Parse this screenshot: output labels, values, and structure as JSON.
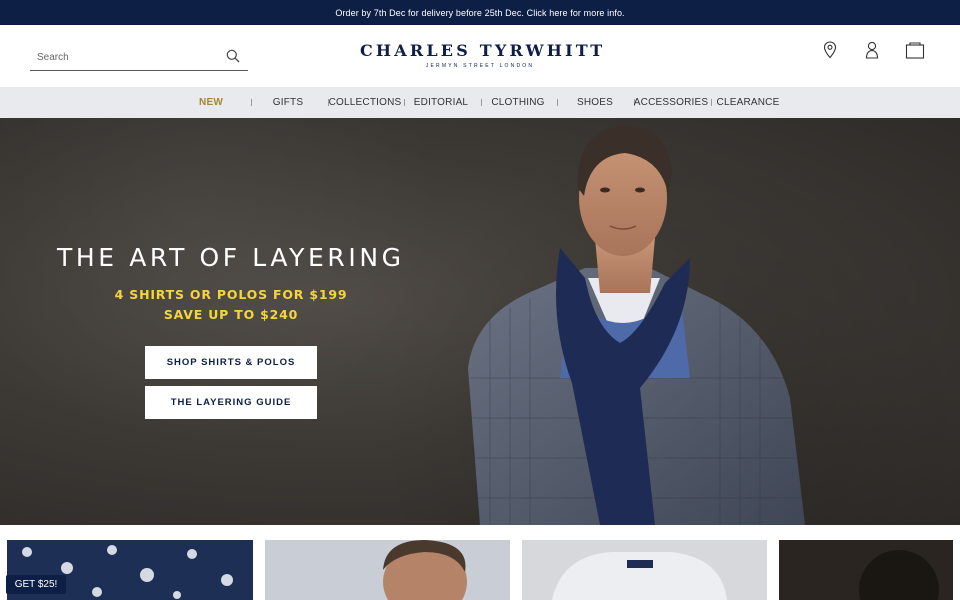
{
  "promo": {
    "text": "Order by 7th Dec for delivery before 25th Dec. Click here for more info."
  },
  "search": {
    "placeholder": "Search"
  },
  "brand": {
    "name": "CHARLES TYRWHITT",
    "tagline": "JERMYN STREET LONDON",
    "color": "#0d1f45"
  },
  "header_icons": [
    "location-pin-icon",
    "account-icon",
    "shopping-bag-icon"
  ],
  "nav": {
    "items": [
      {
        "label": "NEW",
        "active": true
      },
      {
        "label": "GIFTS"
      },
      {
        "label": "COLLECTIONS"
      },
      {
        "label": "EDITORIAL"
      },
      {
        "label": "CLOTHING"
      },
      {
        "label": "SHOES"
      },
      {
        "label": "ACCESSORIES"
      },
      {
        "label": "CLEARANCE"
      }
    ]
  },
  "hero": {
    "title": "THE ART OF LAYERING",
    "offer_line1": "4 SHIRTS OR POLOS FOR $199",
    "offer_line2": "SAVE UP TO $240",
    "button_primary": "SHOP SHIRTS & POLOS",
    "button_secondary": "THE LAYERING GUIDE"
  },
  "cards": [
    {
      "name": "card-floral-shirt"
    },
    {
      "name": "card-man-portrait"
    },
    {
      "name": "card-folded-knit"
    },
    {
      "name": "card-dark-portrait"
    }
  ],
  "badge": {
    "label": "GET $25!"
  },
  "colors": {
    "navy": "#0d1f45",
    "gold": "#a88630",
    "offer_yellow": "#f5d63a",
    "nav_bg": "#e9eaee"
  }
}
